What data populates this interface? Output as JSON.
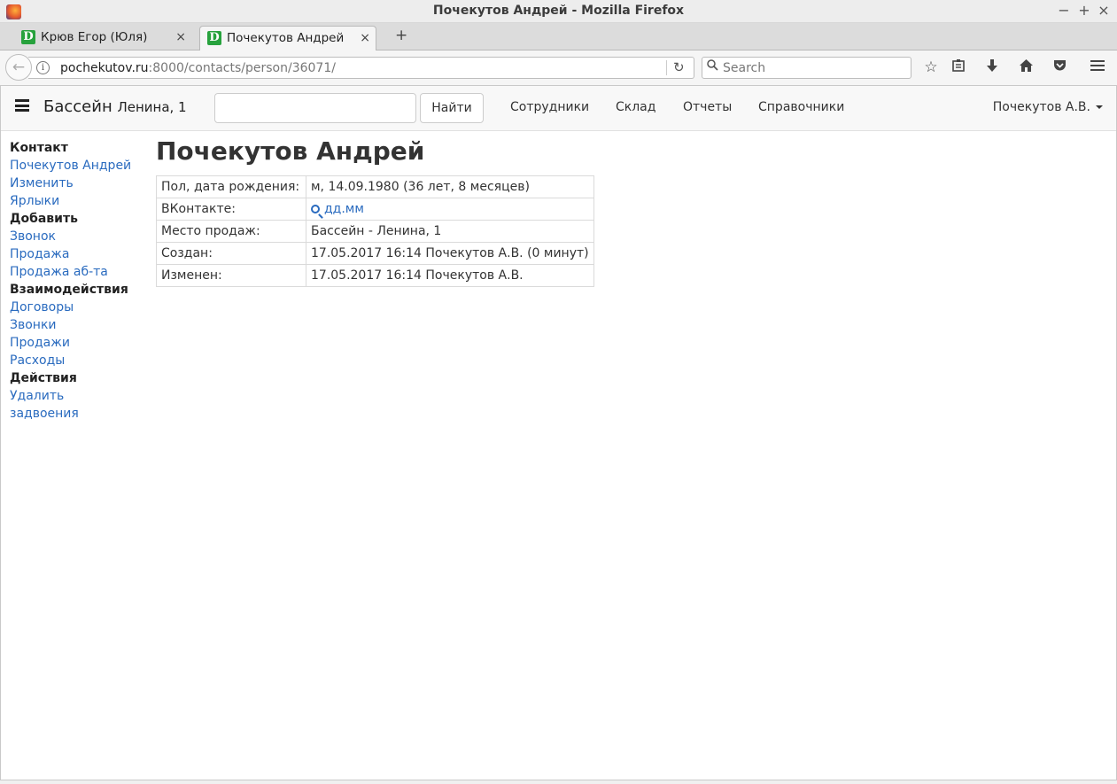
{
  "window": {
    "title": "Почекутов Андрей - Mozilla Firefox",
    "minimize": "−",
    "maximize": "+",
    "close": "×"
  },
  "tabs": [
    {
      "label": "Крюв Егор (Юля)",
      "favicon": "D",
      "close": "×"
    },
    {
      "label": "Почекутов Андрей",
      "favicon": "D",
      "close": "×"
    }
  ],
  "new_tab": "+",
  "urlbar": {
    "host": "pochekutov.ru",
    "path": ":8000/contacts/person/36071/"
  },
  "browser_search": {
    "placeholder": "Search"
  },
  "toolbar_icons": [
    "star-icon",
    "reading-list-icon",
    "download-icon",
    "home-icon",
    "pocket-icon",
    "menu-icon"
  ],
  "app": {
    "brand": "Бассейн",
    "brand_sub": "Ленина, 1",
    "search_value": "",
    "find_button": "Найти",
    "nav": [
      "Сотрудники",
      "Склад",
      "Отчеты",
      "Справочники"
    ],
    "user": "Почекутов А.В."
  },
  "sidebar": {
    "sections": [
      {
        "title": "Контакт",
        "links": [
          "Почекутов Андрей",
          "Изменить",
          "Ярлыки"
        ]
      },
      {
        "title": "Добавить",
        "links": [
          "Звонок",
          "Продажа",
          "Продажа аб-та"
        ]
      },
      {
        "title": "Взаимодействия",
        "links": [
          "Договоры",
          "Звонки",
          "Продажи",
          "Расходы"
        ]
      },
      {
        "title": "Действия",
        "links": [
          "Удалить",
          "задвоения"
        ]
      }
    ]
  },
  "contact": {
    "name": "Почекутов Андрей",
    "rows": [
      {
        "key": "Пол, дата рождения:",
        "value": "м, 14.09.1980 (36 лет, 8 месяцев)"
      },
      {
        "key": "ВКонтакте:",
        "value": "дд.мм"
      },
      {
        "key": "Место продаж:",
        "value": "Бассейн - Ленина, 1"
      },
      {
        "key": "Создан:",
        "value": "17.05.2017 16:14 Почекутов А.В. (0 минут)"
      },
      {
        "key": "Изменен:",
        "value": "17.05.2017 16:14 Почекутов А.В."
      }
    ]
  }
}
